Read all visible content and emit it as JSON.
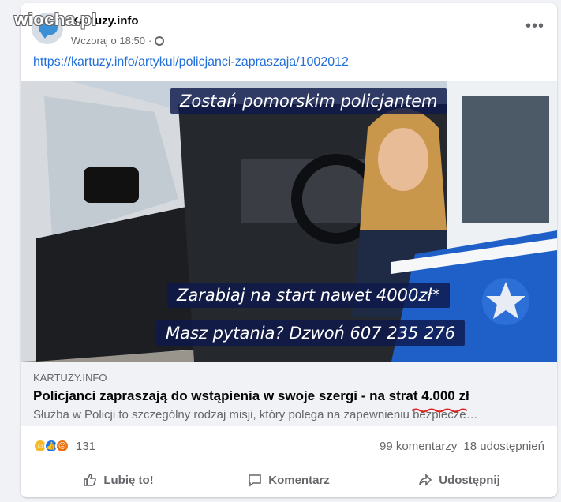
{
  "watermark": "wiocha.pl",
  "post": {
    "page_name": "Kartuzy.info",
    "timestamp": "Wczoraj o 18:50",
    "separator": "·",
    "link_text": "https://kartuzy.info/artykul/policjanci-zapraszaja/1002012",
    "more_icon": "more-horizontal-icon"
  },
  "image": {
    "banner_top": "Zostań pomorskim policjantem",
    "banner_pay": "Zarabiaj na start nawet 4000zł*",
    "banner_phone": "Masz pytania? Dzwoń 607 235 276"
  },
  "preview": {
    "domain": "KARTUZY.INFO",
    "title": "Policjanci zapraszają do wstąpienia w swoje szergi - na strat 4.000 zł",
    "description": "Służba w Policji to szczególny rodzaj misji, który polega na zapewnieniu bezpiecze…"
  },
  "stats": {
    "reaction_count": "131",
    "comments": "99 komentarzy",
    "shares": "18 udostępnień"
  },
  "actions": {
    "like": "Lubię to!",
    "comment": "Komentarz",
    "share": "Udostępnij"
  },
  "colors": {
    "link": "#216fdb",
    "banner": "#0e194b",
    "underline": "#e02020"
  }
}
